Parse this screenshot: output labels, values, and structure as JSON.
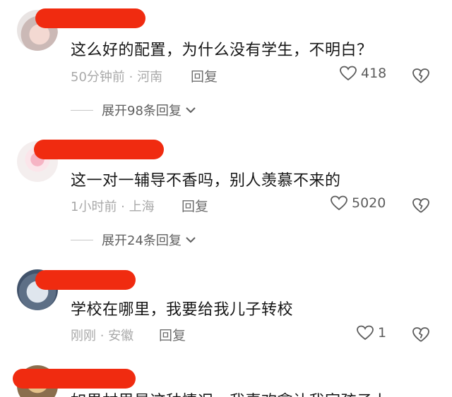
{
  "comments": [
    {
      "text": "这么好的配置，为什么没有学生，不明白？",
      "meta": "50分钟前 · 河南",
      "reply": "回复",
      "likes": "418",
      "expand": "展开98条回复"
    },
    {
      "text": "这一对一辅导不香吗，别人羡慕不来的",
      "meta": "1小时前 · 上海",
      "reply": "回复",
      "likes": "5020",
      "expand": "展开24条回复"
    },
    {
      "text": "学校在哪里，我要给我儿子转校",
      "meta": "刚刚 · 安徽",
      "reply": "回复",
      "likes": "1"
    },
    {
      "text": "如果村里是这种情况，我喜欢拿让我家孩子上"
    }
  ],
  "colors": {
    "redaction": "#f02b10",
    "text": "#161616",
    "meta": "#a9a9a9",
    "icon": "#5c5c5c"
  },
  "icons": {
    "like": "heart-outline-icon",
    "dislike": "broken-heart-icon",
    "expand": "chevron-down-icon"
  }
}
